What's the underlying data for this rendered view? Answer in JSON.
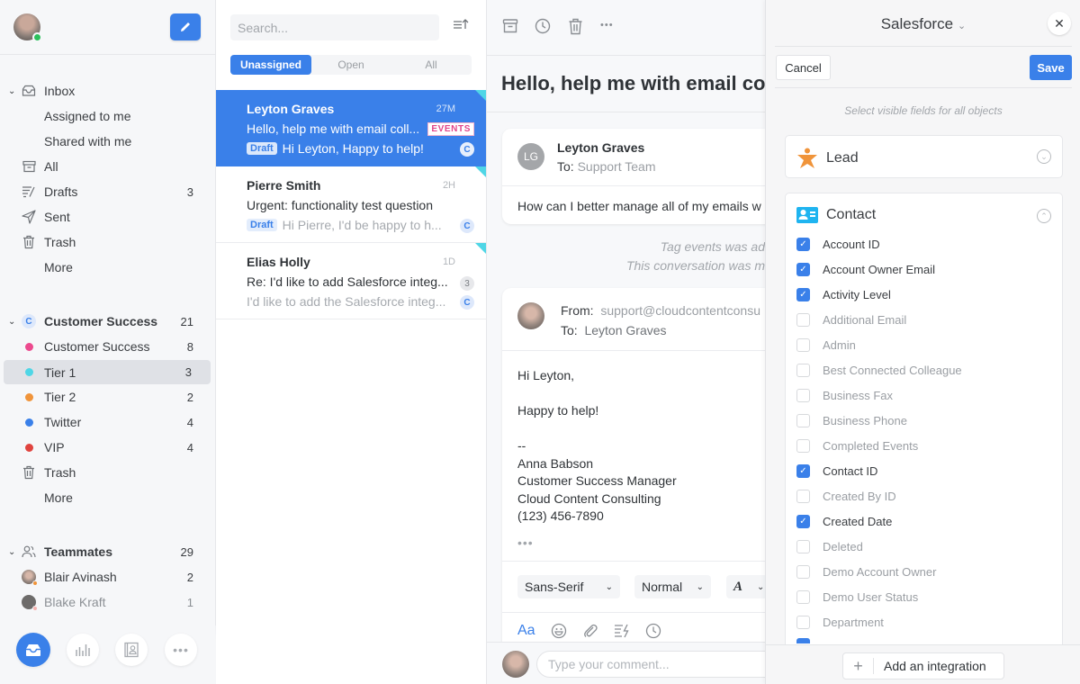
{
  "sidebar": {
    "inbox_section": {
      "label": "Inbox",
      "items": [
        {
          "label": "Assigned to me"
        },
        {
          "label": "Shared with me"
        },
        {
          "label": "All",
          "icon": "archive-icon"
        },
        {
          "label": "Drafts",
          "icon": "drafts-icon",
          "count": "3"
        },
        {
          "label": "Sent",
          "icon": "send-icon"
        },
        {
          "label": "Trash",
          "icon": "trash-icon"
        },
        {
          "label": "More"
        }
      ]
    },
    "team_section": {
      "label": "Customer Success",
      "badge": "C",
      "count": "21",
      "items": [
        {
          "label": "Customer Success",
          "count": "8",
          "color": "#ec4a8e"
        },
        {
          "label": "Tier 1",
          "count": "3",
          "color": "#4fd6e6",
          "selected": true
        },
        {
          "label": "Tier 2",
          "count": "2",
          "color": "#f0943a"
        },
        {
          "label": "Twitter",
          "count": "4",
          "color": "#3a80e9"
        },
        {
          "label": "VIP",
          "count": "4",
          "color": "#e0443f"
        },
        {
          "label": "Trash",
          "icon": "trash-icon"
        },
        {
          "label": "More"
        }
      ]
    },
    "teammates_section": {
      "label": "Teammates",
      "count": "29",
      "items": [
        {
          "label": "Blair Avinash",
          "count": "2",
          "status_color": "#f0943a"
        },
        {
          "label": "Blake Kraft",
          "count": "1",
          "status_color": "#f4b2b0"
        }
      ]
    },
    "bottom_nav": [
      {
        "name": "inbox-nav",
        "icon": "inbox-tray-icon",
        "active": true
      },
      {
        "name": "analytics-nav",
        "icon": "bar-chart-icon"
      },
      {
        "name": "contacts-nav",
        "icon": "contact-card-icon"
      },
      {
        "name": "more-nav",
        "icon": "more-dots-icon"
      }
    ]
  },
  "list": {
    "search_placeholder": "Search...",
    "tabs": [
      {
        "label": "Unassigned",
        "active": true
      },
      {
        "label": "Open"
      },
      {
        "label": "All"
      }
    ],
    "conversations": [
      {
        "name": "Leyton Graves",
        "time": "27M",
        "subject": "Hello, help me with email coll...",
        "tag": "EVENTS",
        "draft": "Draft",
        "preview": "Hi Leyton, Happy to help!",
        "badge": "C",
        "selected": true
      },
      {
        "name": "Pierre Smith",
        "time": "2H",
        "subject": "Urgent: functionality test question",
        "draft": "Draft",
        "preview": "Hi Pierre, I'd be happy to h...",
        "badge": "C"
      },
      {
        "name": "Elias Holly",
        "time": "1D",
        "subject": "Re: I'd like to add Salesforce integ...",
        "count": "3",
        "preview": "I'd like to add the Salesforce integ...",
        "badge": "C"
      }
    ]
  },
  "conversation": {
    "title": "Hello, help me with email co",
    "message": {
      "initials": "LG",
      "from_name": "Leyton Graves",
      "to_label": "To:",
      "to_value": "Support Team",
      "body": "How can I better manage all of my emails w"
    },
    "system_notes": [
      "Tag events was ad",
      "This conversation was m"
    ],
    "reply": {
      "from_label": "From:",
      "from_value": "support@cloudcontentconsu",
      "to_label": "To:",
      "to_value": "Leyton Graves",
      "body": "Hi Leyton,\n\nHappy to help!\n\n--\nAnna Babson\nCustomer Success Manager\nCloud Content Consulting\n(123) 456-7890",
      "ellipsis": "•••"
    },
    "format_bar": {
      "font": "Sans-Serif",
      "size": "Normal",
      "style_glyph": "A"
    },
    "compose_icons": [
      "text-format-icon",
      "emoji-icon",
      "attachment-icon",
      "snippet-icon",
      "clock-icon"
    ],
    "text_format_label": "Aa",
    "comment_placeholder": "Type your comment..."
  },
  "panel": {
    "title": "Salesforce",
    "cancel_label": "Cancel",
    "save_label": "Save",
    "hint": "Select visible fields for all objects",
    "objects": [
      {
        "label": "Lead",
        "expanded": false
      },
      {
        "label": "Contact",
        "expanded": true
      }
    ],
    "contact_fields": [
      {
        "label": "Account ID",
        "checked": true
      },
      {
        "label": "Account Owner Email",
        "checked": true
      },
      {
        "label": "Activity Level",
        "checked": true
      },
      {
        "label": "Additional Email",
        "checked": false
      },
      {
        "label": "Admin",
        "checked": false
      },
      {
        "label": "Best Connected Colleague",
        "checked": false
      },
      {
        "label": "Business Fax",
        "checked": false
      },
      {
        "label": "Business Phone",
        "checked": false
      },
      {
        "label": "Completed Events",
        "checked": false
      },
      {
        "label": "Contact ID",
        "checked": true
      },
      {
        "label": "Created By ID",
        "checked": false
      },
      {
        "label": "Created Date",
        "checked": true
      },
      {
        "label": "Deleted",
        "checked": false
      },
      {
        "label": "Demo Account Owner",
        "checked": false
      },
      {
        "label": "Demo User Status",
        "checked": false
      },
      {
        "label": "Department",
        "checked": false
      }
    ],
    "add_integration_label": "Add an integration"
  },
  "colors": {
    "accent": "#3a80e9",
    "events_tag": "#e2458a",
    "online": "#2cc05c",
    "lead_icon": "#f0943a",
    "contact_icon": "#1fb4f0"
  }
}
